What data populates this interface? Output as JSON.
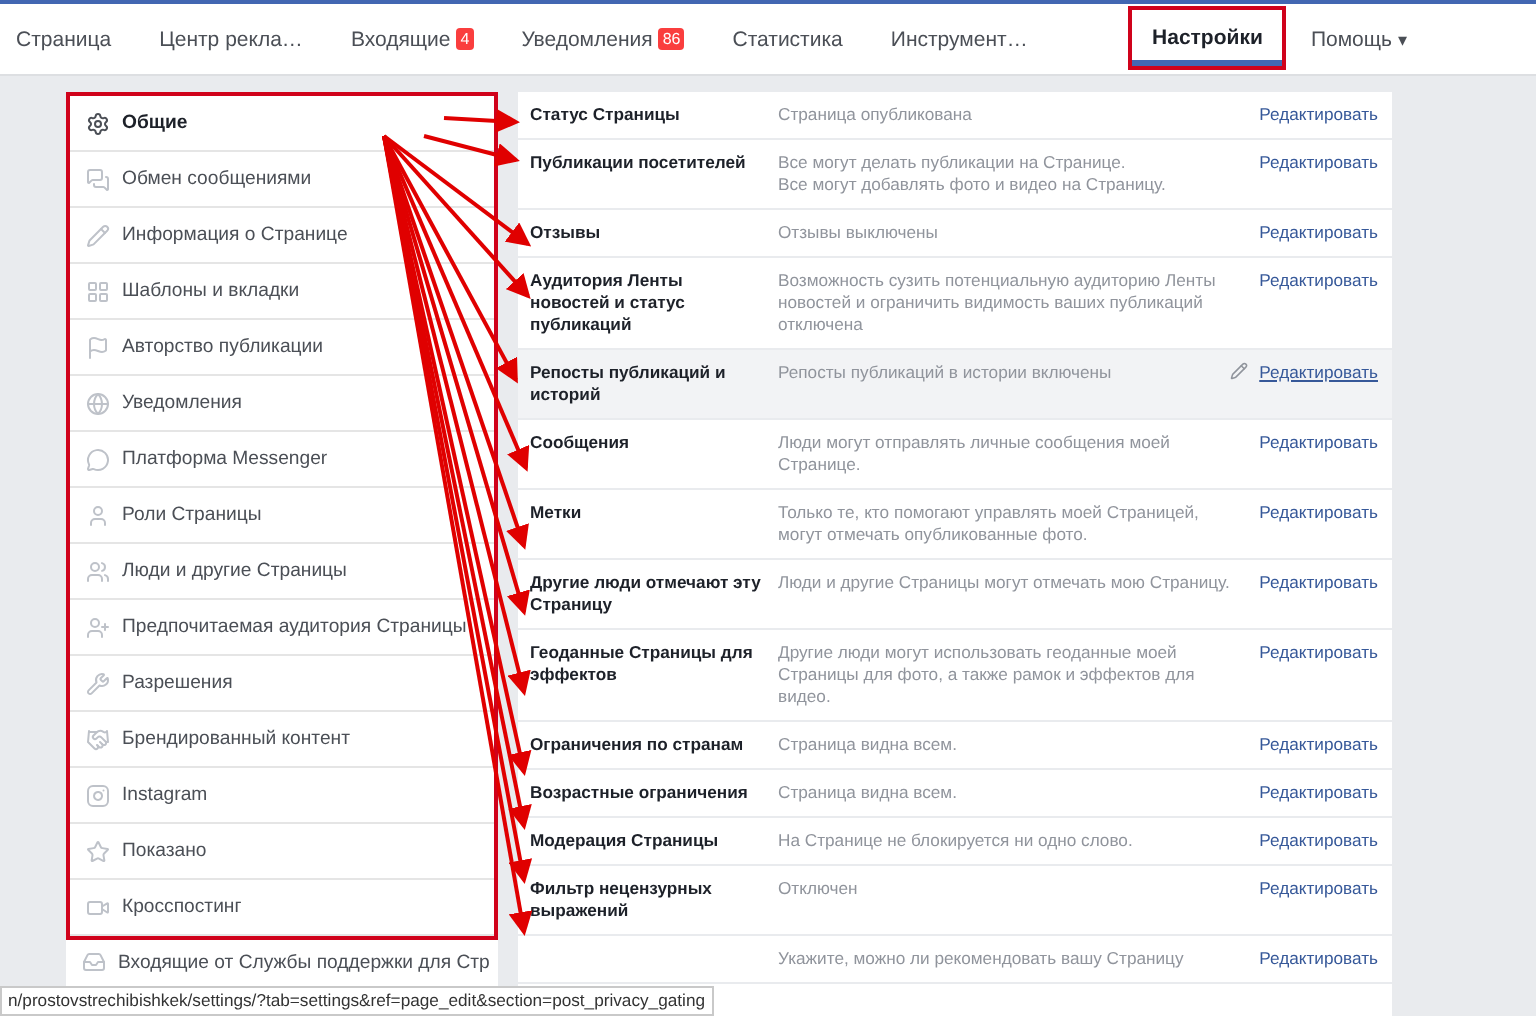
{
  "nav": {
    "tabs": [
      {
        "label": "Страница",
        "selected": false
      },
      {
        "label": "Центр рекла…",
        "selected": false
      },
      {
        "label": "Входящие",
        "badge": "4",
        "selected": false
      },
      {
        "label": "Уведомления",
        "badge": "86",
        "selected": false
      },
      {
        "label": "Статистика",
        "selected": false
      },
      {
        "label": "Инструмент…",
        "selected": false
      },
      {
        "label": "Настройки",
        "selected": true
      },
      {
        "label": "Помощь",
        "caret": "▾",
        "selected": false
      }
    ]
  },
  "sidebar": {
    "items": [
      {
        "label": "Общие",
        "selected": true
      },
      {
        "label": "Обмен сообщениями",
        "selected": false
      },
      {
        "label": "Информация о Странице",
        "selected": false
      },
      {
        "label": "Шаблоны и вкладки",
        "selected": false
      },
      {
        "label": "Авторство публикации",
        "selected": false
      },
      {
        "label": "Уведомления",
        "selected": false
      },
      {
        "label": "Платформа Messenger",
        "selected": false
      },
      {
        "label": "Роли Страницы",
        "selected": false
      },
      {
        "label": "Люди и другие Страницы",
        "selected": false
      },
      {
        "label": "Предпочитаемая аудитория Страницы",
        "selected": false
      },
      {
        "label": "Разрешения",
        "selected": false
      },
      {
        "label": "Брендированный контент",
        "selected": false
      },
      {
        "label": "Instagram",
        "selected": false
      },
      {
        "label": "Показано",
        "selected": false
      },
      {
        "label": "Кросспостинг",
        "selected": false
      },
      {
        "label": "Входящие от Службы поддержки для Стр",
        "selected": false
      }
    ]
  },
  "settings": {
    "rows": [
      {
        "label": "Статус Страницы",
        "description": "Страница опубликована",
        "action": "Редактировать",
        "hovered": false
      },
      {
        "label": "Публикации посетителей",
        "description": "Все могут делать публикации на Странице.\nВсе могут добавлять фото и видео на Страницу.",
        "action": "Редактировать",
        "hovered": false
      },
      {
        "label": "Отзывы",
        "description": "Отзывы выключены",
        "action": "Редактировать",
        "hovered": false
      },
      {
        "label": "Аудитория Ленты новостей и статус публикаций",
        "description": "Возможность сузить потенциальную аудиторию Ленты новостей и ограничить видимость ваших публикаций отключена",
        "action": "Редактировать",
        "hovered": false
      },
      {
        "label": "Репосты публикаций и историй",
        "description": "Репосты публикаций в истории включены",
        "action": "Редактировать",
        "hovered": true
      },
      {
        "label": "Сообщения",
        "description": "Люди могут отправлять личные сообщения моей Странице.",
        "action": "Редактировать",
        "hovered": false
      },
      {
        "label": "Метки",
        "description": "Только те, кто помогают управлять моей Страницей, могут отмечать опубликованные фото.",
        "action": "Редактировать",
        "hovered": false
      },
      {
        "label": "Другие люди отмечают эту Страницу",
        "description": "Люди и другие Страницы могут отмечать мою Страницу.",
        "action": "Редактировать",
        "hovered": false
      },
      {
        "label": "Геоданные Страницы для эффектов",
        "description": "Другие люди могут использовать геоданные моей Страницы для фото, а также рамок и эффектов для видео.",
        "action": "Редактировать",
        "hovered": false
      },
      {
        "label": "Ограничения по странам",
        "description": "Страница видна всем.",
        "action": "Редактировать",
        "hovered": false
      },
      {
        "label": "Возрастные ограничения",
        "description": "Страница видна всем.",
        "action": "Редактировать",
        "hovered": false
      },
      {
        "label": "Модерация Страницы",
        "description": "На Странице не блокируется ни одно слово.",
        "action": "Редактировать",
        "hovered": false
      },
      {
        "label": "Фильтр нецензурных выражений",
        "description": "Отключен",
        "action": "Редактировать",
        "hovered": false
      },
      {
        "description": "Укажите, можно ли рекомендовать вашу Страницу",
        "action": "Редактировать",
        "hovered": false
      }
    ]
  },
  "status_bar": {
    "url": "n/prostovstrechibishkek/settings/?tab=settings&ref=page_edit&section=post_privacy_gating"
  }
}
